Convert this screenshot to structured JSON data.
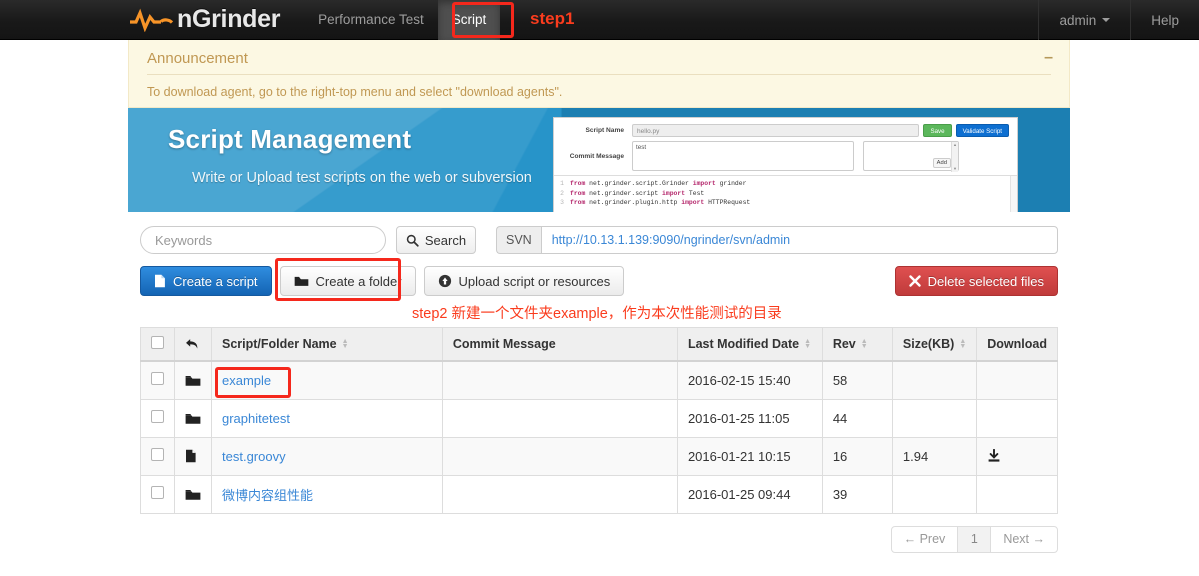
{
  "navbar": {
    "brand": "nGrinder",
    "items": [
      {
        "label": "Performance Test",
        "active": false
      },
      {
        "label": "Script",
        "active": true
      }
    ],
    "annotation_step1": "step1",
    "user": "admin",
    "help": "Help"
  },
  "announcement": {
    "title": "Announcement",
    "body": "To download agent, go to the right-top menu and select \"download agents\".",
    "collapse_glyph": "–"
  },
  "banner": {
    "title": "Script Management",
    "subtitle": "Write or Upload test scripts on the web or subversion",
    "preview": {
      "script_name_label": "Script Name",
      "script_name_value": "hello.py",
      "save_label": "Save",
      "validate_label": "Validate Script",
      "commit_message_label": "Commit Message",
      "commit_message_value": "test",
      "add_label": "Add",
      "code_lines": [
        {
          "n": "1",
          "kw1": "from",
          "mid": " net.grinder.script.Grinder ",
          "kw2": "import",
          "tail": " grinder"
        },
        {
          "n": "2",
          "kw1": "from",
          "mid": " net.grinder.script ",
          "kw2": "import",
          "tail": " Test"
        },
        {
          "n": "3",
          "kw1": "from",
          "mid": " net.grinder.plugin.http ",
          "kw2": "import",
          "tail": " HTTPRequest"
        }
      ]
    }
  },
  "toolbar": {
    "search_placeholder": "Keywords",
    "search_value": "",
    "search_button": "Search",
    "svn_label": "SVN",
    "svn_url": "http://10.13.1.139:9090/ngrinder/svn/admin",
    "create_script": "Create a script",
    "create_folder": "Create a folder",
    "upload": "Upload script or resources",
    "delete_selected": "Delete selected files",
    "annotation_step2": "step2 新建一个文件夹example，作为本次性能测试的目录"
  },
  "table": {
    "headers": {
      "name": "Script/Folder Name",
      "commit": "Commit Message",
      "date": "Last Modified Date",
      "rev": "Rev",
      "size": "Size(KB)",
      "download": "Download"
    },
    "rows": [
      {
        "icon": "folder-icon",
        "name": "example",
        "commit": "",
        "date": "2016-02-15 15:40",
        "rev": "58",
        "size": "",
        "download": false,
        "highlighted": true
      },
      {
        "icon": "folder-icon",
        "name": "graphitetest",
        "commit": "",
        "date": "2016-01-25 11:05",
        "rev": "44",
        "size": "",
        "download": false,
        "highlighted": false
      },
      {
        "icon": "file-icon",
        "name": "test.groovy",
        "commit": "",
        "date": "2016-01-21 10:15",
        "rev": "16",
        "size": "1.94",
        "download": true,
        "highlighted": false
      },
      {
        "icon": "folder-icon",
        "name": "微博内容组性能",
        "commit": "",
        "date": "2016-01-25 09:44",
        "rev": "39",
        "size": "",
        "download": false,
        "highlighted": false
      }
    ]
  },
  "pagination": {
    "prev": "← Prev",
    "current": "1",
    "next": "Next →"
  },
  "colors": {
    "accent_red": "#fa3c1e",
    "link_blue": "#3a87d6",
    "banner_blue": "#1f8fc4",
    "announce_bg": "#fcf8e3"
  }
}
